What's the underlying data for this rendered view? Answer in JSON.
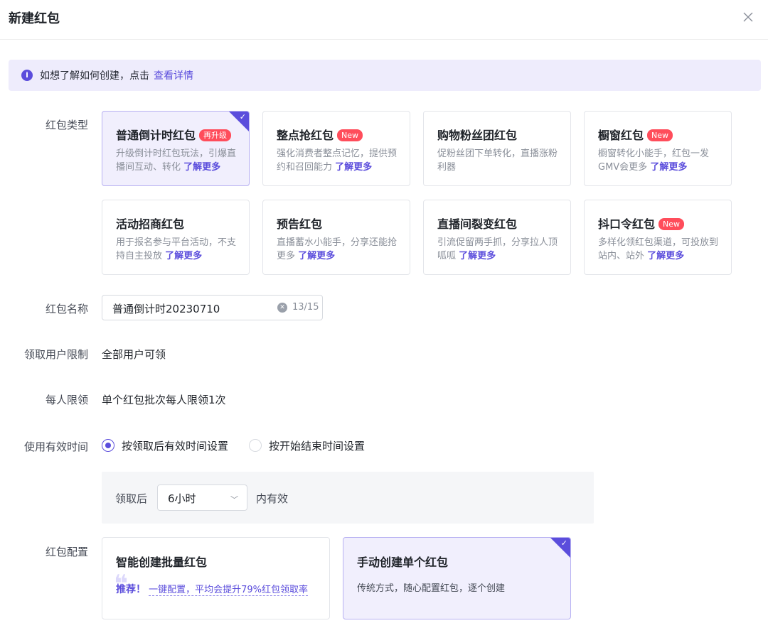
{
  "dialog": {
    "title": "新建红包"
  },
  "banner": {
    "text": "如想了解如何创建，点击",
    "link": "查看详情"
  },
  "labels": {
    "type": "红包类型",
    "name": "红包名称",
    "user_limit": "领取用户限制",
    "per_limit": "每人限领",
    "valid_time": "使用有效时间",
    "config": "红包配置"
  },
  "type_cards": [
    {
      "title": "普通倒计时红包",
      "badge": "再升级",
      "desc": "升级倒计时红包玩法，引爆直播间互动、转化",
      "more": "了解更多",
      "selected": true
    },
    {
      "title": "整点抢红包",
      "badge": "New",
      "desc": "强化消费者整点记忆，提供预约和召回能力",
      "more": "了解更多",
      "selected": false
    },
    {
      "title": "购物粉丝团红包",
      "badge": "",
      "desc": "促粉丝团下单转化，直播涨粉利器",
      "more": "",
      "selected": false
    },
    {
      "title": "橱窗红包",
      "badge": "New",
      "desc": "橱窗转化小能手，红包一发GMV会更多",
      "more": "了解更多",
      "selected": false
    },
    {
      "title": "活动招商红包",
      "badge": "",
      "desc": "用于报名参与平台活动，不支持自主投放",
      "more": "了解更多",
      "selected": false
    },
    {
      "title": "预告红包",
      "badge": "",
      "desc": "直播蓄水小能手，分享还能抢更多",
      "more": "了解更多",
      "selected": false
    },
    {
      "title": "直播间裂变红包",
      "badge": "",
      "desc": "引流促留两手抓，分享拉人顶呱呱",
      "more": "了解更多",
      "selected": false
    },
    {
      "title": "抖口令红包",
      "badge": "New",
      "desc": "多样化领红包渠道，可投放到站内、站外",
      "more": "了解更多",
      "selected": false
    }
  ],
  "name_input": {
    "value": "普通倒计时20230710",
    "count": "13/15"
  },
  "user_limit_value": "全部用户可领",
  "per_limit_value": "单个红包批次每人限领1次",
  "valid_options": [
    {
      "label": "按领取后有效时间设置",
      "checked": true
    },
    {
      "label": "按开始结束时间设置",
      "checked": false
    }
  ],
  "valid_panel": {
    "prefix": "领取后",
    "select_value": "6小时",
    "suffix": "内有效"
  },
  "config_cards": [
    {
      "title": "智能创建批量红包",
      "rec_label": "推荐！",
      "rec_text": "一键配置，平均会提升79%红包领取率",
      "selected": false
    },
    {
      "title": "手动创建单个红包",
      "desc": "传统方式，随心配置红包，逐个创建",
      "selected": true
    }
  ],
  "icons": {
    "close": "close-icon",
    "info": "info-icon",
    "check": "check-icon",
    "chevron": "chevron-down-icon",
    "clear": "clear-icon"
  },
  "colors": {
    "accent": "#5b4ddc",
    "badge": "#ff4d5b",
    "selected_bg": "#f1effd",
    "banner_bg": "#eeecfc"
  }
}
